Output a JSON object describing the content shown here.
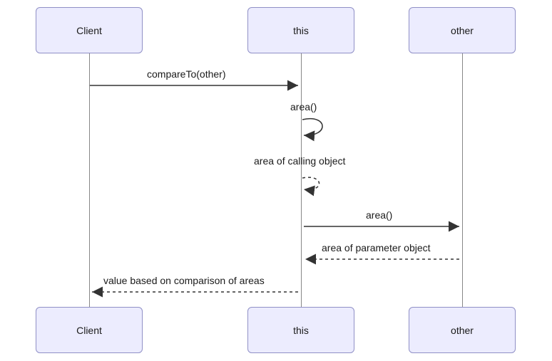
{
  "participants": {
    "client": "Client",
    "this": "this",
    "other": "other"
  },
  "messages": {
    "m1": "compareTo(other)",
    "m2": "area()",
    "m3": "area of calling object",
    "m4": "area()",
    "m5": "area of parameter object",
    "m6": "value based on comparison of areas"
  },
  "chart_data": {
    "type": "sequence_diagram",
    "participants": [
      "Client",
      "this",
      "other"
    ],
    "interactions": [
      {
        "from": "Client",
        "to": "this",
        "label": "compareTo(other)",
        "style": "solid",
        "direction": "right"
      },
      {
        "from": "this",
        "to": "this",
        "label": "area()",
        "style": "solid",
        "direction": "self"
      },
      {
        "from": "this",
        "to": "this",
        "label": "area of calling object",
        "style": "dashed",
        "direction": "self"
      },
      {
        "from": "this",
        "to": "other",
        "label": "area()",
        "style": "solid",
        "direction": "right"
      },
      {
        "from": "other",
        "to": "this",
        "label": "area of parameter object",
        "style": "dashed",
        "direction": "left"
      },
      {
        "from": "this",
        "to": "Client",
        "label": "value based on comparison of areas",
        "style": "dashed",
        "direction": "left"
      }
    ]
  }
}
